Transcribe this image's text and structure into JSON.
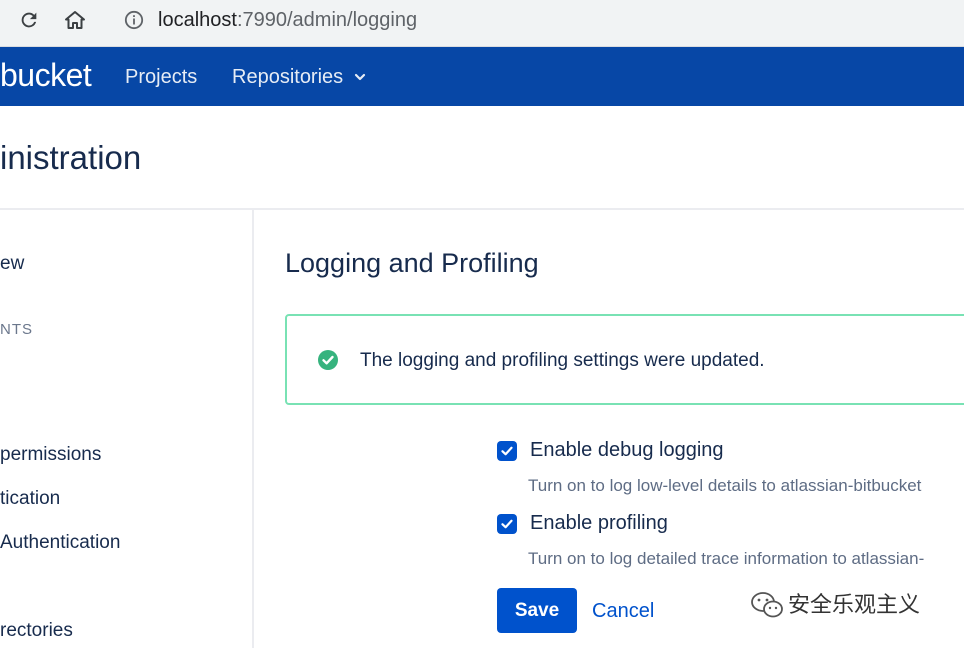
{
  "browser": {
    "url_host": "localhost",
    "url_rest": ":7990/admin/logging"
  },
  "header": {
    "logo": "bucket",
    "nav": {
      "projects": "Projects",
      "repositories": "Repositories"
    }
  },
  "page": {
    "title": "inistration"
  },
  "sidebar": {
    "items": [
      "ew",
      "NTS",
      "permissions",
      "tication",
      "Authentication",
      "rectories"
    ]
  },
  "main": {
    "title": "Logging and Profiling",
    "success_message": "The logging and profiling settings were updated.",
    "options": [
      {
        "label": "Enable debug logging",
        "description": "Turn on to log low-level details to atlassian-bitbucket",
        "checked": true
      },
      {
        "label": "Enable profiling",
        "description": "Turn on to log detailed trace information to atlassian-",
        "checked": true
      }
    ],
    "save_label": "Save",
    "cancel_label": "Cancel"
  },
  "watermark": {
    "text": "安全乐观主义"
  },
  "colors": {
    "header_bg": "#0747a6",
    "primary": "#0052cc",
    "success": "#36b37e",
    "success_border": "#79e2b4"
  }
}
